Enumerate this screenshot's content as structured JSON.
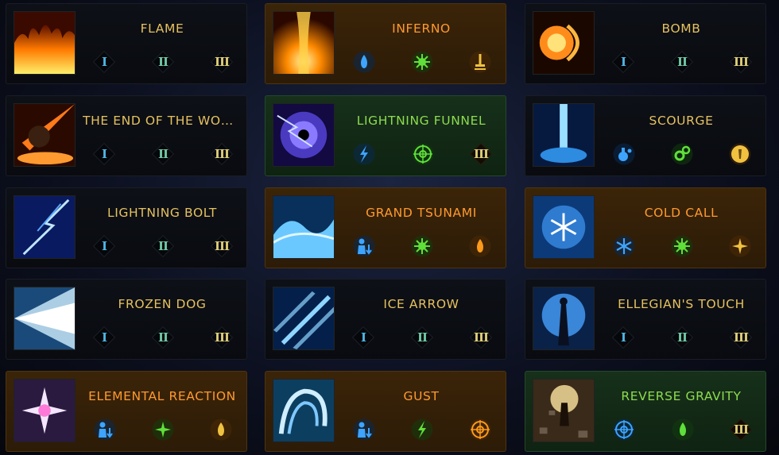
{
  "tier_labels": [
    "I",
    "II",
    "III"
  ],
  "colors": {
    "title_gold": "#e5c15f",
    "title_orange": "#ff9a2e",
    "title_green": "#8ddc4e",
    "card_dark": "#0b0e14",
    "card_orange": "#33200a",
    "card_green": "#132a16"
  },
  "cards": [
    {
      "title": "FLAME",
      "state": "default",
      "thumb": "fire-wall-art",
      "icons": []
    },
    {
      "title": "INFERNO",
      "state": "orange",
      "thumb": "fire-pillar-art",
      "icons": [
        "blue-flame-icon",
        "green-burst-icon",
        "gold-sword-icon"
      ]
    },
    {
      "title": "BOMB",
      "state": "default",
      "thumb": "fireball-art",
      "icons": []
    },
    {
      "title": "THE END OF THE WOR…",
      "state": "default",
      "thumb": "meteor-art",
      "icons": []
    },
    {
      "title": "LIGHTNING FUNNEL",
      "state": "green",
      "thumb": "lightning-vortex-art",
      "icons": [
        "blue-lightning-icon",
        "green-target-icon",
        "tier-III-icon"
      ]
    },
    {
      "title": "SCOURGE",
      "state": "default",
      "thumb": "ice-geyser-art",
      "icons": [
        "blue-potion-icon",
        "green-gears-icon",
        "gold-rune-orb-icon"
      ]
    },
    {
      "title": "LIGHTNING BOLT",
      "state": "default",
      "thumb": "lightning-bolt-art",
      "icons": []
    },
    {
      "title": "GRAND TSUNAMI",
      "state": "orange",
      "thumb": "wave-art",
      "icons": [
        "blue-figure-down-icon",
        "green-burst-icon",
        "orange-flame-icon"
      ]
    },
    {
      "title": "COLD CALL",
      "state": "orange",
      "thumb": "snowflake-art",
      "icons": [
        "blue-snowflake-icon",
        "green-burst-icon",
        "gold-sparkle-icon"
      ]
    },
    {
      "title": "FROZEN DOG",
      "state": "default",
      "thumb": "frost-spray-art",
      "icons": []
    },
    {
      "title": "ICE ARROW",
      "state": "default",
      "thumb": "ice-shards-art",
      "icons": []
    },
    {
      "title": "ELLEGIAN'S TOUCH",
      "state": "default",
      "thumb": "mage-orb-art",
      "icons": []
    },
    {
      "title": "ELEMENTAL REACTION",
      "state": "orange",
      "thumb": "crystal-burst-art",
      "icons": [
        "blue-figure-down-icon",
        "green-sparkle-icon",
        "gold-flame-icon"
      ]
    },
    {
      "title": "GUST",
      "state": "orange",
      "thumb": "wind-swirl-art",
      "icons": [
        "blue-figure-down-icon",
        "green-lightning-icon",
        "orange-target-icon"
      ]
    },
    {
      "title": "REVERSE GRAVITY",
      "state": "green",
      "thumb": "levitation-art",
      "icons": [
        "blue-target-icon",
        "green-flame-icon",
        "tier-III-icon"
      ]
    }
  ]
}
